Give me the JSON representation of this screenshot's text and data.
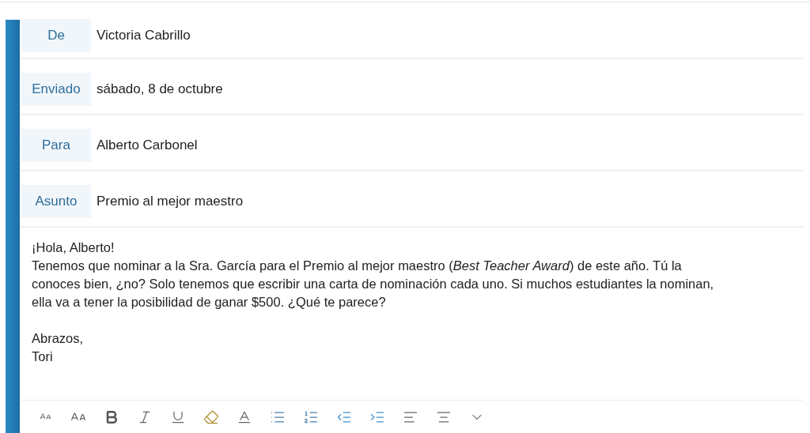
{
  "header_fields": [
    {
      "label": "De",
      "value": "Victoria Cabrillo"
    },
    {
      "label": "Enviado",
      "value": "sábado, 8 de octubre"
    },
    {
      "label": "Para",
      "value": "Alberto Carbonel"
    },
    {
      "label": "Asunto",
      "value": "Premio al mejor maestro"
    }
  ],
  "body": [
    {
      "lines": [
        "¡Hola, Alberto!",
        "Tenemos que nominar a la Sra. García para el Premio al mejor maestro (*Best Teacher Award*) de este año. Tú la",
        "conoces bien, ¿no? Solo tenemos que escribir una carta de nominación cada uno. Si muchos estudiantes la nominan,",
        "ella va a tener la posibilidad de ganar $500. ¿Qué te parece?"
      ]
    },
    {
      "lines": [
        "Abrazos,",
        "Tori"
      ]
    }
  ]
}
